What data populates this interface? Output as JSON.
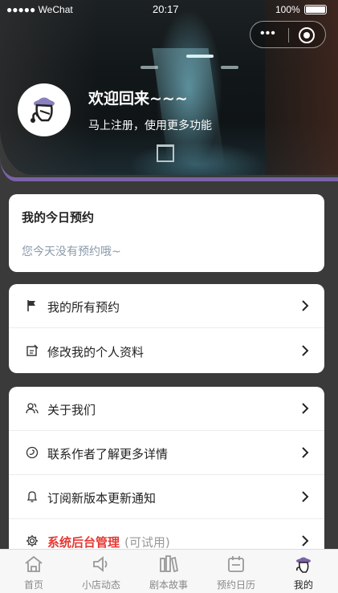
{
  "status_bar": {
    "carrier": "●●●●● WeChat",
    "time": "20:17",
    "battery": "100%"
  },
  "capsule": {
    "more_label": "•••",
    "close_icon": "target-icon"
  },
  "header": {
    "welcome_title": "欢迎回来~~~",
    "welcome_subtitle": "马上注册，使用更多功能",
    "avatar_icon": "detective-avatar-icon"
  },
  "today_card": {
    "title": "我的今日预约",
    "empty_text": "您今天没有预约哦~"
  },
  "menu_group_1": [
    {
      "label": "我的所有预约",
      "icon": "flag-icon"
    },
    {
      "label": "修改我的个人资料",
      "icon": "edit-icon"
    }
  ],
  "menu_group_2": [
    {
      "label": "关于我们",
      "icon": "users-icon"
    },
    {
      "label": "联系作者了解更多详情",
      "icon": "chat-icon"
    },
    {
      "label": "订阅新版本更新通知",
      "icon": "bell-icon"
    },
    {
      "label": "系统后台管理",
      "hint": "(可试用)",
      "icon": "gear-icon"
    }
  ],
  "tabbar": [
    {
      "label": "首页",
      "icon": "home-icon"
    },
    {
      "label": "小店动态",
      "icon": "speaker-icon"
    },
    {
      "label": "剧本故事",
      "icon": "books-icon"
    },
    {
      "label": "预约日历",
      "icon": "calendar-icon"
    },
    {
      "label": "我的",
      "icon": "profile-avatar-icon",
      "active": true
    }
  ],
  "colors": {
    "accent_purple": "#7b62a8",
    "admin_red": "#e53935",
    "page_bg": "#3a3a3a"
  }
}
